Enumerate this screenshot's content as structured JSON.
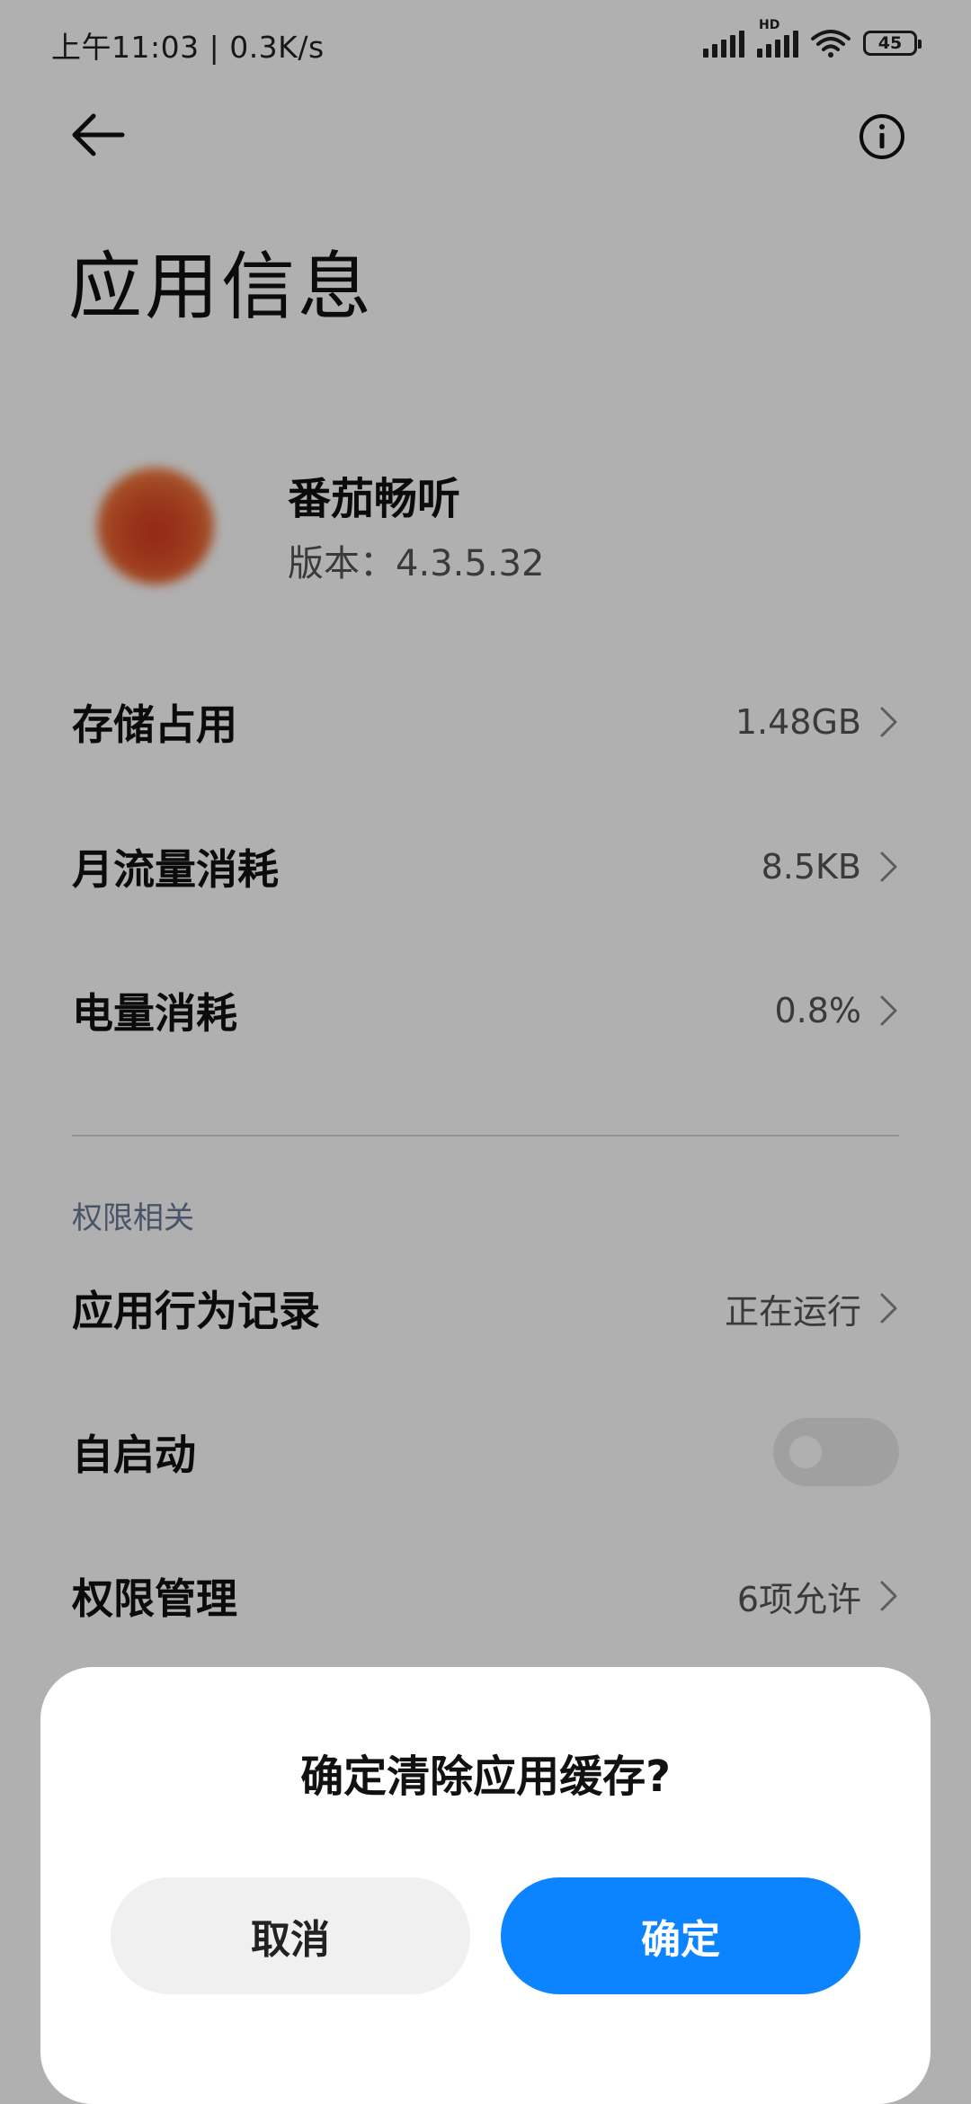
{
  "status_bar": {
    "time_speed": "上午11:03 | 0.3K/s",
    "hd_label": "HD",
    "battery": "45"
  },
  "header": {
    "title": "应用信息"
  },
  "app": {
    "name": "番茄畅听",
    "version": "版本：4.3.5.32"
  },
  "rows": [
    {
      "label": "存储占用",
      "value": "1.48GB"
    },
    {
      "label": "月流量消耗",
      "value": "8.5KB"
    },
    {
      "label": "电量消耗",
      "value": "0.8%"
    }
  ],
  "permissions": {
    "section_title": "权限相关",
    "behavior_label": "应用行为记录",
    "behavior_value": "正在运行",
    "autostart_label": "自启动",
    "autostart_on": false,
    "permission_label": "权限管理",
    "permission_value": "6项允许"
  },
  "dialog": {
    "title": "确定清除应用缓存?",
    "cancel": "取消",
    "confirm": "确定"
  },
  "colors": {
    "confirm_button": "#0d84ff",
    "section_title": "#6b7a99",
    "app_icon": "#e3532a"
  }
}
